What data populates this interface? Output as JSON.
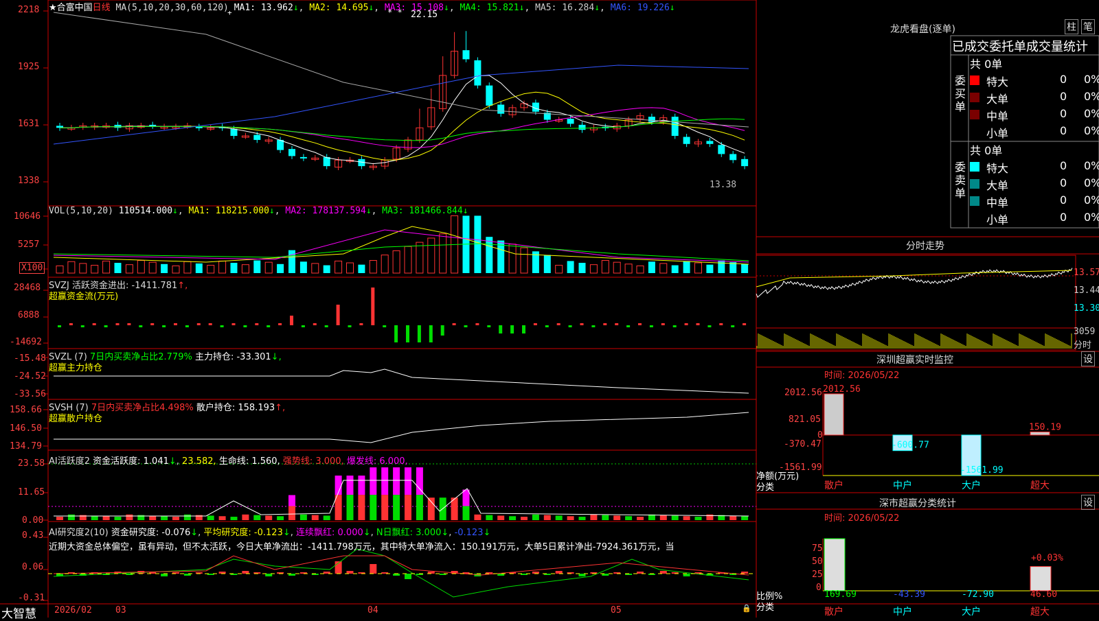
{
  "colors": {
    "up": "#ff3333",
    "down": "#00ffff",
    "green": "#00dd00",
    "white": "#ffffff",
    "yellow": "#ffff00",
    "magenta": "#ff00ff",
    "lime": "#00ff00",
    "blue": "#3355ff",
    "grey": "#aaaaaa",
    "axis": "#cc0000"
  },
  "header": {
    "star": "★",
    "stock": "合富中国",
    "period": "日线",
    "ma_params": "MA(5,10,20,30,60,120)",
    "ma": [
      {
        "label": "MA1:",
        "value": "13.962",
        "arrow": "↓"
      },
      {
        "label": "MA2:",
        "value": "14.695",
        "arrow": "↓"
      },
      {
        "label": "MA3:",
        "value": "15.108",
        "arrow": "↓"
      },
      {
        "label": "MA4:",
        "value": "15.821",
        "arrow": "↓"
      },
      {
        "label": "MA5:",
        "value": "16.284",
        "arrow": "↓"
      },
      {
        "label": "MA6:",
        "value": "19.226",
        "arrow": "↓"
      }
    ]
  },
  "price_axis": [
    "2218",
    "1925",
    "1631",
    "1338"
  ],
  "price_marks": {
    "high": "22.15",
    "last": "13.38"
  },
  "vol_header": {
    "params": "VOL(5,10,20)",
    "vol": "110514.000",
    "ma1": "MA1: 118215.000",
    "ma2": "MA2: 178137.594",
    "ma3": "MA3: 181466.844"
  },
  "vol_axis": [
    "10646",
    "5257",
    "X100"
  ],
  "svzj": {
    "line1": "SVZJ  活跃资金进出: -1411.781",
    "arrow": "↑,",
    "line2": "超赢资金流(万元)",
    "axis": [
      "28468",
      "6888",
      "-14692"
    ]
  },
  "svzl": {
    "params": "SVZL (7)",
    "ratio": "7日内买卖净占比2.779%",
    "hold": "主力持仓: -33.301",
    "arrow": "↓,",
    "line2": "超赢主力持仓",
    "axis": [
      "-15.48",
      "-24.52",
      "-33.56"
    ]
  },
  "svsh": {
    "params": "SVSH (7)",
    "ratio": "7日内买卖净占比4.498%",
    "hold": "散户持仓: 158.193",
    "arrow": "↑,",
    "line2": "超赢散户持仓",
    "axis": [
      "158.66",
      "146.50",
      "134.79"
    ]
  },
  "ai1": {
    "name": "AI活跃度2",
    "a": "资金活跃度: 1.041",
    "a2": "23.582,",
    "b": "生命线: 1.560,",
    "c": "强势线: 3.000,",
    "d": "爆发线: 6.000,",
    "axis": [
      "23.58",
      "11.65",
      "0.00"
    ]
  },
  "ai2": {
    "name": "AI研究度2(10)",
    "a": "资金研究度: -0.076",
    "b": "平均研究度: -0.123",
    "c": "连续飘红: 0.000",
    "d": "N日飘红: 3.000",
    "e": "-0.123",
    "commentary": "近期大资金总体偏空，虽有异动，但不太活跃，今日大单净流出：-1411.798万元，其中特大单净流入：150.191万元，大单5日累计净出-7924.361万元，当",
    "axis": [
      "0.43",
      "0.06",
      "-0.31"
    ]
  },
  "xaxis": {
    "brand": "大智慧",
    "dates": [
      "2026/02",
      "03",
      "04",
      "05"
    ]
  },
  "lhkp": {
    "title": "龙虎看盘(逐单)",
    "btn1": "柱",
    "btn2": "笔",
    "subtitle": "已成交委托单成交量统计",
    "buy": {
      "side": "委买单",
      "total": "共 0单",
      "rows": [
        {
          "name": "特大",
          "val": "0",
          "pct": "0%"
        },
        {
          "name": "大单",
          "val": "0",
          "pct": "0%"
        },
        {
          "name": "中单",
          "val": "0",
          "pct": "0%"
        },
        {
          "name": "小单",
          "val": "0",
          "pct": "0%"
        }
      ]
    },
    "sell": {
      "side": "委卖单",
      "total": "共 0单",
      "rows": [
        {
          "name": "特大",
          "val": "0",
          "pct": "0%"
        },
        {
          "name": "大单",
          "val": "0",
          "pct": "0%"
        },
        {
          "name": "中单",
          "val": "0",
          "pct": "0%"
        },
        {
          "name": "小单",
          "val": "0",
          "pct": "0%"
        }
      ]
    }
  },
  "fenshi": {
    "title": "分时走势",
    "axis": [
      "13.57",
      "13.44",
      "13.30"
    ],
    "vol": "3059",
    "vol_label": "分时"
  },
  "monitor": {
    "title": "深圳超赢实时监控",
    "btn": "设",
    "time": "时间: 2026/05/22",
    "axis": [
      "2012.56",
      "821.05",
      "0",
      "-370.47",
      "-1561.99"
    ],
    "ylabel1": "净额(万元)",
    "ylabel2": "分类",
    "cats": [
      "散户",
      "中户",
      "大户",
      "超大"
    ],
    "values": [
      2012.56,
      -600.77,
      -1561.99,
      150.19
    ],
    "labels": [
      "2012.56",
      "-600.77",
      "-1561.99",
      "150.19"
    ]
  },
  "stat": {
    "title": "深市超赢分类统计",
    "btn": "设",
    "time": "时间: 2026/05/22",
    "axis": [
      "75",
      "50",
      "25",
      "0"
    ],
    "ylabel1": "比例%",
    "ylabel2": "分类",
    "cats": [
      "散户",
      "中户",
      "大户",
      "超大"
    ],
    "values": [
      169.69,
      -43.39,
      -72.9,
      46.6
    ],
    "labels": [
      "169.69",
      "-43.39",
      "-72.90",
      "46.60"
    ],
    "extra": "+0.03%"
  },
  "chart_data": {
    "type": "bar",
    "categories": [
      "散户",
      "中户",
      "大户",
      "超大"
    ],
    "series": [
      {
        "name": "净额(万元)",
        "values": [
          2012.56,
          -600.77,
          -1561.99,
          150.19
        ]
      }
    ],
    "ylim": [
      -1561.99,
      2012.56
    ]
  }
}
